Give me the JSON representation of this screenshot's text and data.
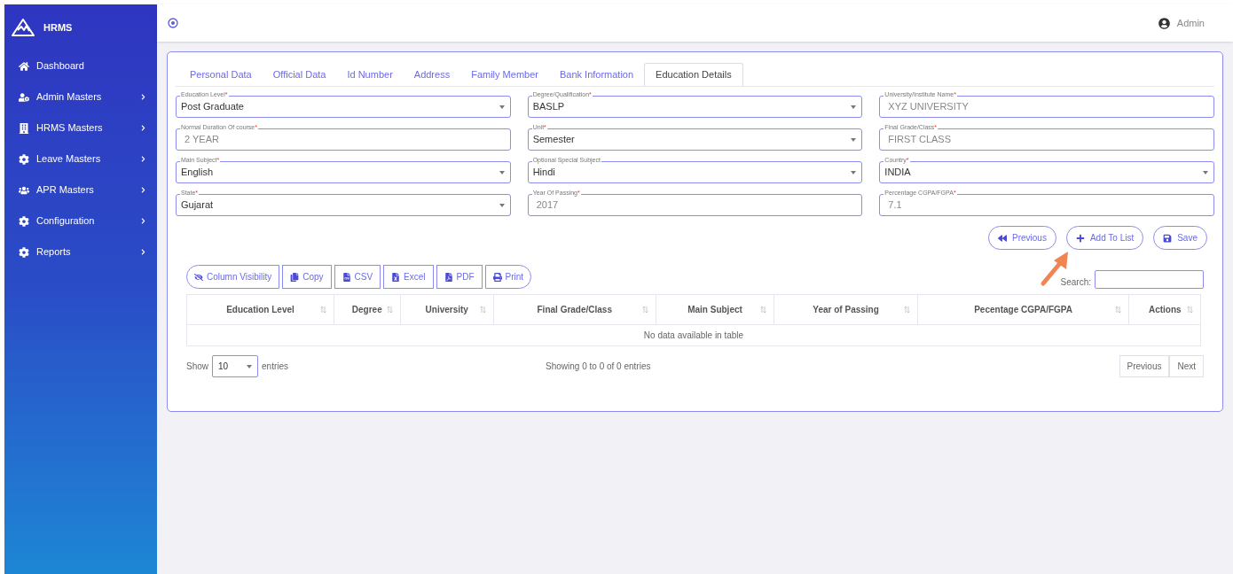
{
  "brand": {
    "name": "HRMS"
  },
  "sidebar": {
    "items": [
      {
        "label": "Dashboard",
        "has_submenu": false
      },
      {
        "label": "Admin Masters",
        "has_submenu": true
      },
      {
        "label": "HRMS Masters",
        "has_submenu": true
      },
      {
        "label": "Leave Masters",
        "has_submenu": true
      },
      {
        "label": "APR Masters",
        "has_submenu": true
      },
      {
        "label": "Configuration",
        "has_submenu": true
      },
      {
        "label": "Reports",
        "has_submenu": true
      }
    ]
  },
  "header": {
    "user": "Admin"
  },
  "tabs": [
    {
      "label": "Personal Data",
      "selected": false
    },
    {
      "label": "Official Data",
      "selected": false
    },
    {
      "label": "Id Number",
      "selected": false
    },
    {
      "label": "Address",
      "selected": false
    },
    {
      "label": "Family Member",
      "selected": false
    },
    {
      "label": "Bank Information",
      "selected": false
    },
    {
      "label": "Education Details",
      "selected": true
    }
  ],
  "fields": [
    {
      "label": "Education Level",
      "required_mark": "*",
      "kind": "select",
      "value": "Post Graduate"
    },
    {
      "label": "Degree/Qualification",
      "required_mark": "*",
      "kind": "select",
      "value": "BASLP"
    },
    {
      "label": "University/Institute Name",
      "required_mark": "*",
      "kind": "input",
      "value": "XYZ UNIVERSITY"
    },
    {
      "label": "Normal Duration Of course",
      "required_mark": "*",
      "kind": "input",
      "value": "2 YEAR"
    },
    {
      "label": "Unit",
      "required_mark": "*",
      "kind": "select",
      "value": "Semester"
    },
    {
      "label": "Final Grade/Class",
      "required_mark": "*",
      "kind": "input",
      "value": "FIRST CLASS"
    },
    {
      "label": "Main Subject",
      "required_mark": "*",
      "kind": "select",
      "value": "English"
    },
    {
      "label": "Optional Special Subject",
      "kind": "select",
      "value": "Hindi"
    },
    {
      "label": "Country",
      "required_mark": "*",
      "kind": "select",
      "value": "INDIA"
    },
    {
      "label": "State",
      "required_mark": "*",
      "kind": "select",
      "value": "Gujarat"
    },
    {
      "label": "Year Of Passing",
      "required_mark": "*",
      "kind": "input",
      "value": "2017"
    },
    {
      "label": "Percentage CGPA/FGPA",
      "required_mark": "*",
      "kind": "input",
      "value": "7.1"
    }
  ],
  "form_actions": [
    {
      "label": "Previous"
    },
    {
      "label": "Add To List"
    },
    {
      "label": "Save"
    }
  ],
  "export_buttons": [
    {
      "label": "Column Visibility"
    },
    {
      "label": "Copy"
    },
    {
      "label": "CSV"
    },
    {
      "label": "Excel"
    },
    {
      "label": "PDF"
    },
    {
      "label": "Print"
    }
  ],
  "search": {
    "label": "Search:"
  },
  "table": {
    "columns": [
      "Education Level",
      "Degree",
      "University",
      "Final Grade/Class",
      "Main Subject",
      "Year of Passing",
      "Pecentage CGPA/FGPA",
      "Actions"
    ],
    "empty_message": "No data available in table"
  },
  "footer": {
    "show_label": "Show",
    "page_size": "10",
    "entries_label": "entries",
    "info": "Showing 0 to 0 of 0 entries",
    "pagination": [
      "Previous",
      "Next"
    ]
  }
}
